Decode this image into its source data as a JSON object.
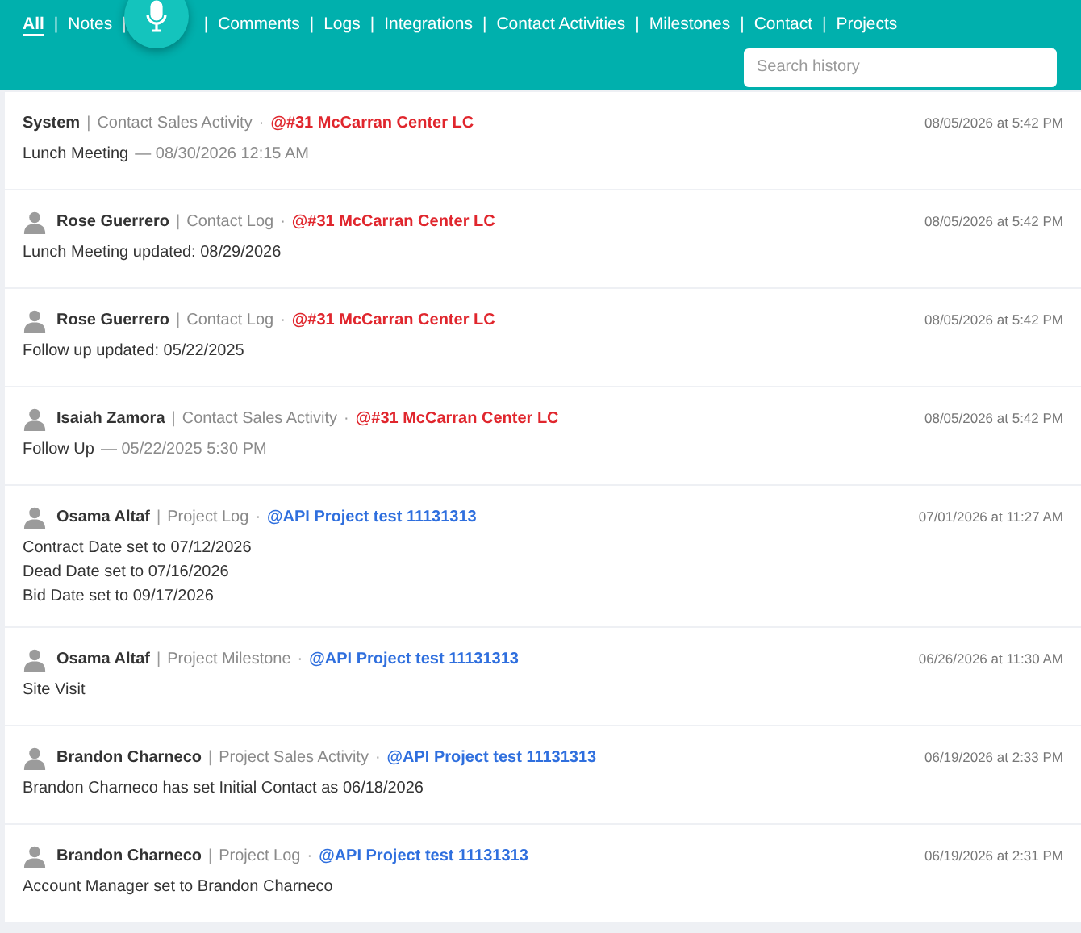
{
  "tabs": [
    {
      "label": "All",
      "selected": true
    },
    {
      "label": "Notes",
      "selected": false
    },
    {
      "label": "Comments",
      "selected": false
    },
    {
      "label": "Logs",
      "selected": false
    },
    {
      "label": "Integrations",
      "selected": false
    },
    {
      "label": "Contact Activities",
      "selected": false
    },
    {
      "label": "Milestones",
      "selected": false
    },
    {
      "label": "Contact",
      "selected": false
    },
    {
      "label": "Projects",
      "selected": false
    }
  ],
  "tab_separator": "|",
  "search": {
    "placeholder": "Search history"
  },
  "entries": [
    {
      "actor": "System",
      "avatar": false,
      "separator": "|",
      "source": "Contact Sales Activity",
      "dot": "·",
      "link": "@#31 McCarran Center LC",
      "color": "#e0262d",
      "time": "08/05/2026 at 5:42 PM",
      "lines": [
        {
          "text": "Lunch Meeting",
          "detail": "— 08/30/2026 12:15 AM"
        }
      ]
    },
    {
      "actor": "Rose Guerrero",
      "avatar": true,
      "separator": "|",
      "source": "Contact Log",
      "dot": "·",
      "link": "@#31 McCarran Center LC",
      "color": "#e0262d",
      "time": "08/05/2026 at 5:42 PM",
      "lines": [
        {
          "text": "Lunch Meeting updated: 08/29/2026"
        }
      ]
    },
    {
      "actor": "Rose Guerrero",
      "avatar": true,
      "separator": "|",
      "source": "Contact Log",
      "dot": "·",
      "link": "@#31 McCarran Center LC",
      "color": "#e0262d",
      "time": "08/05/2026 at 5:42 PM",
      "lines": [
        {
          "text": "Follow up updated: 05/22/2025"
        }
      ]
    },
    {
      "actor": "Isaiah Zamora",
      "avatar": true,
      "separator": "|",
      "source": "Contact Sales Activity",
      "dot": "·",
      "link": "@#31 McCarran Center LC",
      "color": "#e0262d",
      "time": "08/05/2026 at 5:42 PM",
      "lines": [
        {
          "text": "Follow Up",
          "detail": "— 05/22/2025 5:30 PM"
        }
      ]
    },
    {
      "actor": "Osama Altaf",
      "avatar": true,
      "separator": "|",
      "source": "Project Log",
      "dot": "·",
      "link": "@API Project test 11131313",
      "color": "#2f6fde",
      "time": "07/01/2026 at 11:27 AM",
      "lines": [
        {
          "text": "Contract Date set to 07/12/2026"
        },
        {
          "text": "Dead Date set to 07/16/2026"
        },
        {
          "text": "Bid Date set to 09/17/2026"
        }
      ]
    },
    {
      "actor": "Osama Altaf",
      "avatar": true,
      "separator": "|",
      "source": "Project Milestone",
      "dot": "·",
      "link": "@API Project test 11131313",
      "color": "#2f6fde",
      "time": "06/26/2026 at 11:30 AM",
      "lines": [
        {
          "text": "Site Visit"
        }
      ]
    },
    {
      "actor": "Brandon Charneco",
      "avatar": true,
      "separator": "|",
      "source": "Project Sales Activity",
      "dot": "·",
      "link": "@API Project test 11131313",
      "color": "#2f6fde",
      "time": "06/19/2026 at 2:33 PM",
      "lines": [
        {
          "text": "Brandon Charneco has set Initial Contact as 06/18/2026"
        }
      ]
    },
    {
      "actor": "Brandon Charneco",
      "avatar": true,
      "separator": "|",
      "source": "Project Log",
      "dot": "·",
      "link": "@API Project test 11131313",
      "color": "#2f6fde",
      "time": "06/19/2026 at 2:31 PM",
      "lines": [
        {
          "text": "Account Manager set to Brandon Charneco"
        }
      ]
    }
  ]
}
